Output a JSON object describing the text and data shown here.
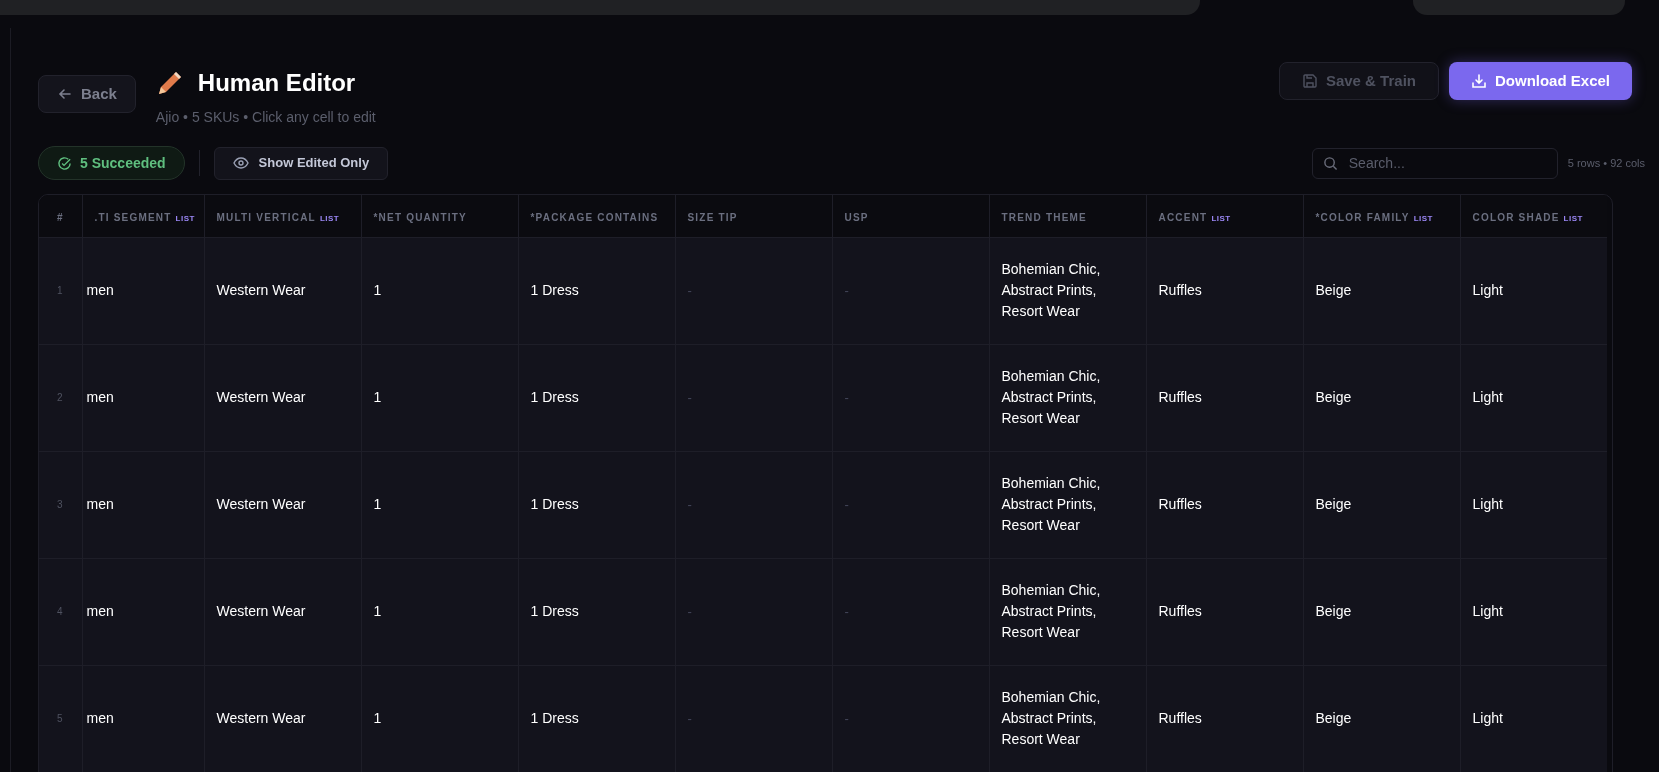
{
  "header": {
    "back": "Back",
    "title": "Human Editor",
    "subtitle": "Ajio • 5 SKUs • Click any cell to edit",
    "save": {
      "label": "Save & Train",
      "disabled": true
    },
    "download": "Download Excel"
  },
  "toolbar": {
    "status": "5 Succeeded",
    "filter": {
      "label": "Show Edited Only",
      "selected": false
    },
    "search": {
      "placeholder": "Search..."
    },
    "summary": "5 rows • 92 cols"
  },
  "table": {
    "columns": [
      {
        "label": "#"
      },
      {
        "label": ".TI SEGMENT",
        "tag": "LIST"
      },
      {
        "label": "MULTI VERTICAL",
        "tag": "LIST"
      },
      {
        "label": "*NET QUANTITY"
      },
      {
        "label": "*PACKAGE CONTAINS"
      },
      {
        "label": "SIZE TIP"
      },
      {
        "label": "USP"
      },
      {
        "label": "TREND THEME"
      },
      {
        "label": "ACCENT",
        "tag": "LIST"
      },
      {
        "label": "*COLOR FAMILY",
        "tag": "LIST"
      },
      {
        "label": "COLOR SHADE",
        "tag": "LIST"
      }
    ],
    "rows": [
      [
        {
          "kind": "index",
          "text": "1"
        },
        {
          "kind": "value",
          "text": "men"
        },
        {
          "kind": "value",
          "text": "Western Wear"
        },
        {
          "kind": "value",
          "text": "1"
        },
        {
          "kind": "value",
          "text": "1 Dress"
        },
        {
          "kind": "empty",
          "text": "-"
        },
        {
          "kind": "empty",
          "text": "-"
        },
        {
          "kind": "value",
          "text": "Bohemian Chic, Abstract Prints, Resort Wear"
        },
        {
          "kind": "value",
          "text": "Ruffles"
        },
        {
          "kind": "value",
          "text": "Beige"
        },
        {
          "kind": "value",
          "text": "Light"
        }
      ],
      [
        {
          "kind": "index",
          "text": "2"
        },
        {
          "kind": "value",
          "text": "men"
        },
        {
          "kind": "value",
          "text": "Western Wear"
        },
        {
          "kind": "value",
          "text": "1"
        },
        {
          "kind": "value",
          "text": "1 Dress"
        },
        {
          "kind": "empty",
          "text": "-"
        },
        {
          "kind": "empty",
          "text": "-"
        },
        {
          "kind": "value",
          "text": "Bohemian Chic, Abstract Prints, Resort Wear"
        },
        {
          "kind": "value",
          "text": "Ruffles"
        },
        {
          "kind": "value",
          "text": "Beige"
        },
        {
          "kind": "value",
          "text": "Light"
        }
      ],
      [
        {
          "kind": "index",
          "text": "3"
        },
        {
          "kind": "value",
          "text": "men"
        },
        {
          "kind": "value",
          "text": "Western Wear"
        },
        {
          "kind": "value",
          "text": "1"
        },
        {
          "kind": "value",
          "text": "1 Dress"
        },
        {
          "kind": "empty",
          "text": "-"
        },
        {
          "kind": "empty",
          "text": "-"
        },
        {
          "kind": "value",
          "text": "Bohemian Chic, Abstract Prints, Resort Wear"
        },
        {
          "kind": "value",
          "text": "Ruffles"
        },
        {
          "kind": "value",
          "text": "Beige"
        },
        {
          "kind": "value",
          "text": "Light"
        }
      ],
      [
        {
          "kind": "index",
          "text": "4"
        },
        {
          "kind": "value",
          "text": "men"
        },
        {
          "kind": "value",
          "text": "Western Wear"
        },
        {
          "kind": "value",
          "text": "1"
        },
        {
          "kind": "value",
          "text": "1 Dress"
        },
        {
          "kind": "empty",
          "text": "-"
        },
        {
          "kind": "empty",
          "text": "-"
        },
        {
          "kind": "value",
          "text": "Bohemian Chic, Abstract Prints, Resort Wear"
        },
        {
          "kind": "value",
          "text": "Ruffles"
        },
        {
          "kind": "value",
          "text": "Beige"
        },
        {
          "kind": "value",
          "text": "Light"
        }
      ],
      [
        {
          "kind": "index",
          "text": "5"
        },
        {
          "kind": "value",
          "text": "men"
        },
        {
          "kind": "value",
          "text": "Western Wear"
        },
        {
          "kind": "value",
          "text": "1"
        },
        {
          "kind": "value",
          "text": "1 Dress"
        },
        {
          "kind": "empty",
          "text": "-"
        },
        {
          "kind": "empty",
          "text": "-"
        },
        {
          "kind": "value",
          "text": "Bohemian Chic, Abstract Prints, Resort Wear"
        },
        {
          "kind": "value",
          "text": "Ruffles"
        },
        {
          "kind": "value",
          "text": "Beige"
        },
        {
          "kind": "value",
          "text": "Light"
        }
      ]
    ]
  }
}
